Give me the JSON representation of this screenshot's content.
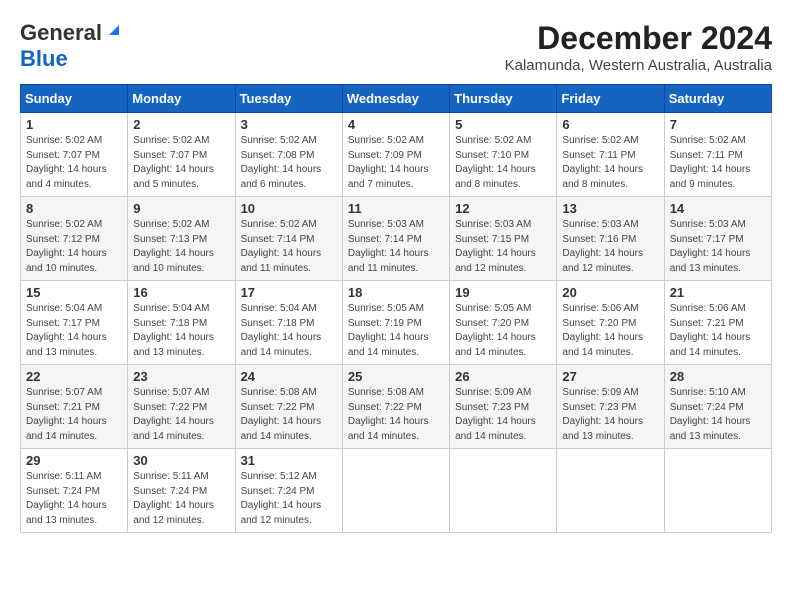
{
  "logo": {
    "line1": "General",
    "line2": "Blue"
  },
  "title": "December 2024",
  "subtitle": "Kalamunda, Western Australia, Australia",
  "days_of_week": [
    "Sunday",
    "Monday",
    "Tuesday",
    "Wednesday",
    "Thursday",
    "Friday",
    "Saturday"
  ],
  "weeks": [
    [
      {
        "day": 1,
        "detail": "Sunrise: 5:02 AM\nSunset: 7:07 PM\nDaylight: 14 hours\nand 4 minutes."
      },
      {
        "day": 2,
        "detail": "Sunrise: 5:02 AM\nSunset: 7:07 PM\nDaylight: 14 hours\nand 5 minutes."
      },
      {
        "day": 3,
        "detail": "Sunrise: 5:02 AM\nSunset: 7:08 PM\nDaylight: 14 hours\nand 6 minutes."
      },
      {
        "day": 4,
        "detail": "Sunrise: 5:02 AM\nSunset: 7:09 PM\nDaylight: 14 hours\nand 7 minutes."
      },
      {
        "day": 5,
        "detail": "Sunrise: 5:02 AM\nSunset: 7:10 PM\nDaylight: 14 hours\nand 8 minutes."
      },
      {
        "day": 6,
        "detail": "Sunrise: 5:02 AM\nSunset: 7:11 PM\nDaylight: 14 hours\nand 8 minutes."
      },
      {
        "day": 7,
        "detail": "Sunrise: 5:02 AM\nSunset: 7:11 PM\nDaylight: 14 hours\nand 9 minutes."
      }
    ],
    [
      {
        "day": 8,
        "detail": "Sunrise: 5:02 AM\nSunset: 7:12 PM\nDaylight: 14 hours\nand 10 minutes."
      },
      {
        "day": 9,
        "detail": "Sunrise: 5:02 AM\nSunset: 7:13 PM\nDaylight: 14 hours\nand 10 minutes."
      },
      {
        "day": 10,
        "detail": "Sunrise: 5:02 AM\nSunset: 7:14 PM\nDaylight: 14 hours\nand 11 minutes."
      },
      {
        "day": 11,
        "detail": "Sunrise: 5:03 AM\nSunset: 7:14 PM\nDaylight: 14 hours\nand 11 minutes."
      },
      {
        "day": 12,
        "detail": "Sunrise: 5:03 AM\nSunset: 7:15 PM\nDaylight: 14 hours\nand 12 minutes."
      },
      {
        "day": 13,
        "detail": "Sunrise: 5:03 AM\nSunset: 7:16 PM\nDaylight: 14 hours\nand 12 minutes."
      },
      {
        "day": 14,
        "detail": "Sunrise: 5:03 AM\nSunset: 7:17 PM\nDaylight: 14 hours\nand 13 minutes."
      }
    ],
    [
      {
        "day": 15,
        "detail": "Sunrise: 5:04 AM\nSunset: 7:17 PM\nDaylight: 14 hours\nand 13 minutes."
      },
      {
        "day": 16,
        "detail": "Sunrise: 5:04 AM\nSunset: 7:18 PM\nDaylight: 14 hours\nand 13 minutes."
      },
      {
        "day": 17,
        "detail": "Sunrise: 5:04 AM\nSunset: 7:18 PM\nDaylight: 14 hours\nand 14 minutes."
      },
      {
        "day": 18,
        "detail": "Sunrise: 5:05 AM\nSunset: 7:19 PM\nDaylight: 14 hours\nand 14 minutes."
      },
      {
        "day": 19,
        "detail": "Sunrise: 5:05 AM\nSunset: 7:20 PM\nDaylight: 14 hours\nand 14 minutes."
      },
      {
        "day": 20,
        "detail": "Sunrise: 5:06 AM\nSunset: 7:20 PM\nDaylight: 14 hours\nand 14 minutes."
      },
      {
        "day": 21,
        "detail": "Sunrise: 5:06 AM\nSunset: 7:21 PM\nDaylight: 14 hours\nand 14 minutes."
      }
    ],
    [
      {
        "day": 22,
        "detail": "Sunrise: 5:07 AM\nSunset: 7:21 PM\nDaylight: 14 hours\nand 14 minutes."
      },
      {
        "day": 23,
        "detail": "Sunrise: 5:07 AM\nSunset: 7:22 PM\nDaylight: 14 hours\nand 14 minutes."
      },
      {
        "day": 24,
        "detail": "Sunrise: 5:08 AM\nSunset: 7:22 PM\nDaylight: 14 hours\nand 14 minutes."
      },
      {
        "day": 25,
        "detail": "Sunrise: 5:08 AM\nSunset: 7:22 PM\nDaylight: 14 hours\nand 14 minutes."
      },
      {
        "day": 26,
        "detail": "Sunrise: 5:09 AM\nSunset: 7:23 PM\nDaylight: 14 hours\nand 14 minutes."
      },
      {
        "day": 27,
        "detail": "Sunrise: 5:09 AM\nSunset: 7:23 PM\nDaylight: 14 hours\nand 13 minutes."
      },
      {
        "day": 28,
        "detail": "Sunrise: 5:10 AM\nSunset: 7:24 PM\nDaylight: 14 hours\nand 13 minutes."
      }
    ],
    [
      {
        "day": 29,
        "detail": "Sunrise: 5:11 AM\nSunset: 7:24 PM\nDaylight: 14 hours\nand 13 minutes."
      },
      {
        "day": 30,
        "detail": "Sunrise: 5:11 AM\nSunset: 7:24 PM\nDaylight: 14 hours\nand 12 minutes."
      },
      {
        "day": 31,
        "detail": "Sunrise: 5:12 AM\nSunset: 7:24 PM\nDaylight: 14 hours\nand 12 minutes."
      },
      null,
      null,
      null,
      null
    ]
  ]
}
